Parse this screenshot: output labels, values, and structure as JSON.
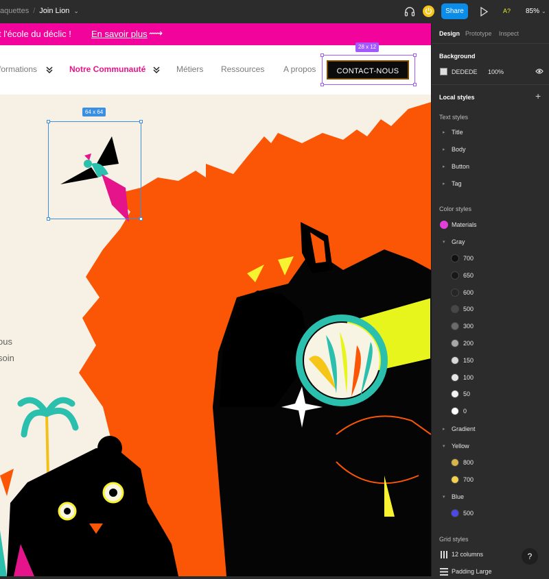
{
  "toolbar": {
    "project": "aquettes",
    "separator": "/",
    "file_name": "Join Lion",
    "share_label": "Share",
    "a11y_label": "A?",
    "zoom": "85%"
  },
  "banner": {
    "message": "t l'école du déclic !",
    "link": "En savoir plus",
    "arrow": "⟿"
  },
  "nav": {
    "items": [
      {
        "label": "formations"
      },
      {
        "label": "Notre Communauté"
      },
      {
        "label": "Métiers"
      },
      {
        "label": "Ressources"
      },
      {
        "label": "A propos"
      }
    ],
    "cta": "CONTACT-NOUS"
  },
  "selection": {
    "contact_size": "28 x 12",
    "bird_size": "64 x 64"
  },
  "side_text": [
    "ous",
    "soin"
  ],
  "panel": {
    "tabs": [
      "Design",
      "Prototype",
      "Inspect"
    ],
    "background_title": "Background",
    "background_hex": "DEDEDE",
    "background_opacity": "100%",
    "local_styles": "Local styles",
    "text_styles_title": "Text styles",
    "text_styles": [
      "Title",
      "Body",
      "Button",
      "Tag"
    ],
    "color_styles_title": "Color styles",
    "materials": {
      "label": "Materials",
      "color": "#e040d8"
    },
    "gray": {
      "label": "Gray",
      "shades": [
        {
          "label": "700",
          "color": "#111111"
        },
        {
          "label": "650",
          "color": "#181818"
        },
        {
          "label": "600",
          "color": "#262626"
        },
        {
          "label": "500",
          "color": "#474747"
        },
        {
          "label": "300",
          "color": "#6b6b6b"
        },
        {
          "label": "200",
          "color": "#a7a7a7"
        },
        {
          "label": "150",
          "color": "#d9d9d9"
        },
        {
          "label": "100",
          "color": "#e6e6e6"
        },
        {
          "label": "50",
          "color": "#f2f2f2"
        },
        {
          "label": "0",
          "color": "#ffffff"
        }
      ]
    },
    "gradient": "Gradient",
    "yellow": {
      "label": "Yellow",
      "shades": [
        {
          "label": "800",
          "color": "#d9b44a"
        },
        {
          "label": "700",
          "color": "#f5d04e"
        }
      ]
    },
    "blue": {
      "label": "Blue",
      "shades": [
        {
          "label": "500",
          "color": "#4a4ae8"
        }
      ]
    },
    "grid_styles_title": "Grid styles",
    "grids": [
      "12 columns",
      "Padding Large"
    ],
    "help": "?"
  }
}
